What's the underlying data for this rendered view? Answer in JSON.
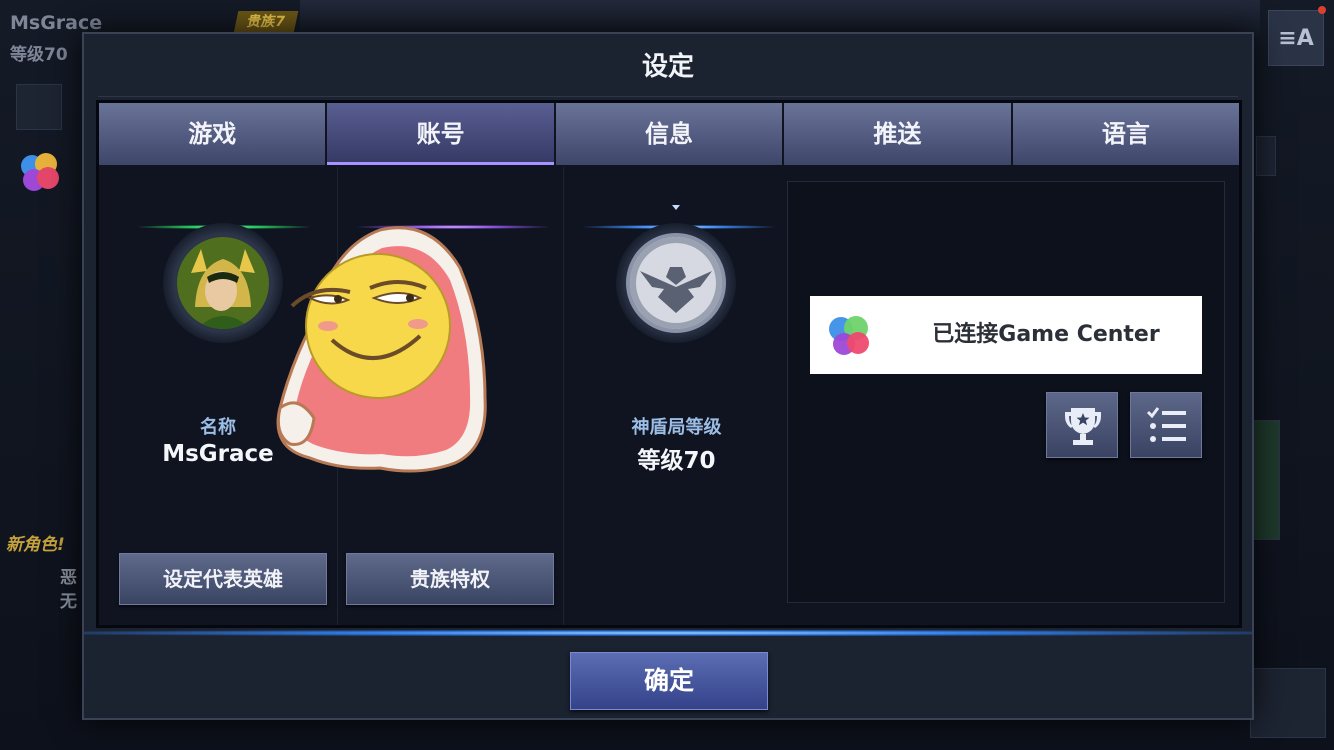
{
  "background": {
    "player_name": "MsGrace",
    "player_level": "等级70",
    "badge": "贵族7",
    "menu_label": "≡A",
    "new_character_label": "新角色!",
    "side_text": "恶\n无"
  },
  "dialog": {
    "title": "设定",
    "tabs": [
      {
        "label": "游戏",
        "active": false
      },
      {
        "label": "账号",
        "active": true
      },
      {
        "label": "信息",
        "active": false
      },
      {
        "label": "推送",
        "active": false
      },
      {
        "label": "语言",
        "active": false
      }
    ],
    "account": {
      "name_label": "名称",
      "name_value": "MsGrace",
      "shield_label": "神盾局等级",
      "shield_value": "等级70",
      "set_hero_button": "设定代表英雄",
      "noble_button": "贵族特权"
    },
    "game_center": {
      "status": "已连接Game Center",
      "trophy_icon": "trophy-icon",
      "list_icon": "checklist-icon"
    },
    "confirm_button": "确定"
  },
  "colors": {
    "tab_active_underline": "#a991ff",
    "label_blue": "#9bbde6",
    "glow_green": "#23c45c",
    "glow_purple": "#8b52e0",
    "glow_blue": "#3b86ef"
  }
}
